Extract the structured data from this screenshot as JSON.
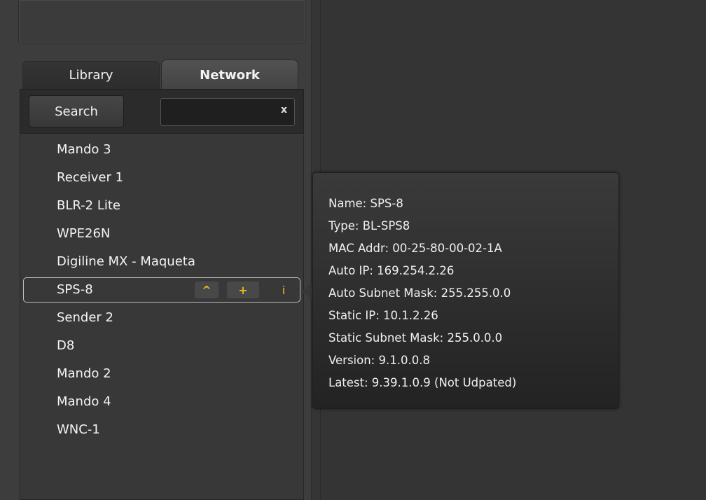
{
  "tabs": {
    "library_label": "Library",
    "network_label": "Network",
    "active": "Network"
  },
  "search": {
    "button_label": "Search",
    "value": "",
    "placeholder": "",
    "clear_label": "x"
  },
  "devices": [
    {
      "label": "Mando 3"
    },
    {
      "label": "Receiver 1"
    },
    {
      "label": "BLR-2 Lite"
    },
    {
      "label": "WPE26N"
    },
    {
      "label": "Digiline MX - Maqueta"
    },
    {
      "label": "SPS-8",
      "selected": true
    },
    {
      "label": "Sender 2"
    },
    {
      "label": "D8"
    },
    {
      "label": "Mando 2"
    },
    {
      "label": "Mando 4"
    },
    {
      "label": "WNC-1"
    }
  ],
  "selected_actions": {
    "move_up": "^",
    "add": "+",
    "info": "i"
  },
  "tooltip": {
    "lines": [
      "Name: SPS-8",
      "Type: BL-SPS8",
      "MAC Addr: 00-25-80-00-02-1A",
      "Auto IP: 169.254.2.26",
      "Auto Subnet Mask: 255.255.0.0",
      "Static IP: 10.1.2.26",
      "Static Subnet Mask: 255.0.0.0",
      "Version: 9.1.0.0.8",
      "Latest: 9.39.1.0.9 (Not Udpated)"
    ]
  },
  "colors": {
    "accent": "#e8b820",
    "text": "#f4f4f4",
    "panel": "#383838"
  }
}
